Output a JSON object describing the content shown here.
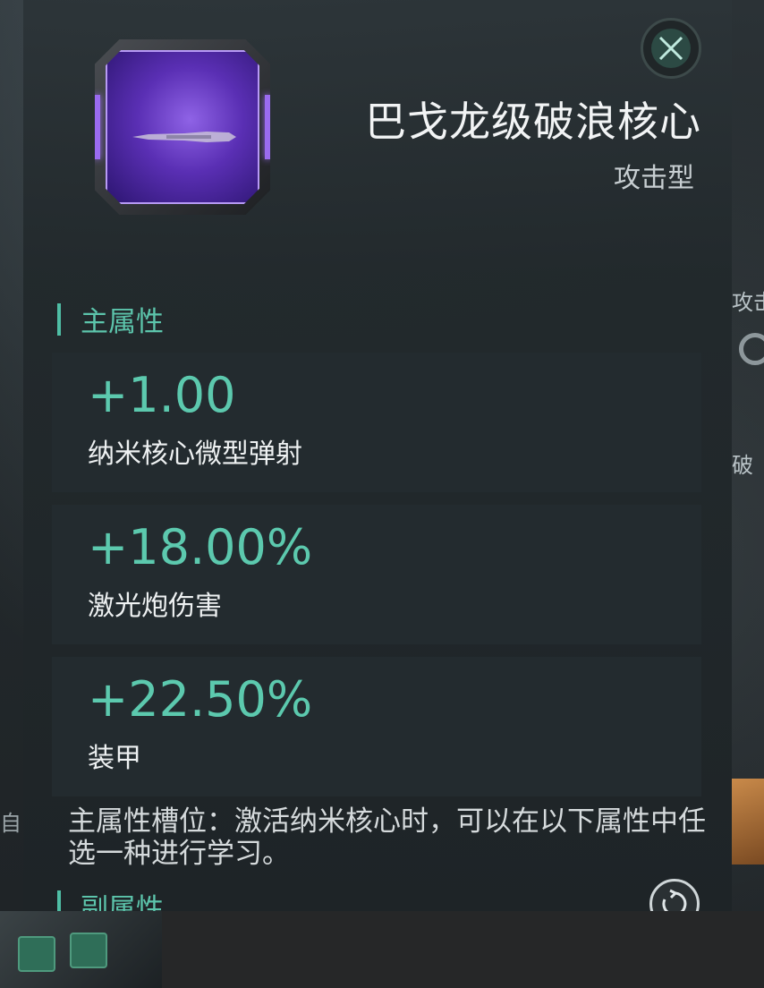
{
  "item": {
    "title": "巴戈龙级破浪核心",
    "type": "攻击型",
    "icon": "battleship-core-icon"
  },
  "main_attributes": {
    "header": "主属性",
    "stats": [
      {
        "value": "+1.00",
        "label": "纳米核心微型弹射"
      },
      {
        "value": "+18.00%",
        "label": "激光炮伤害"
      },
      {
        "value": "+22.50%",
        "label": "装甲"
      }
    ],
    "note": "主属性槽位：激活纳米核心时，可以在以下属性中任选一种进行学习。"
  },
  "sub_attributes": {
    "header": "副属性"
  },
  "background": {
    "right_text_1": "攻击",
    "right_text_2": "破",
    "left_text": "自"
  },
  "colors": {
    "accent": "#5cc9ae",
    "icon_purple": "#6a3fd0",
    "panel": "#252c30"
  }
}
